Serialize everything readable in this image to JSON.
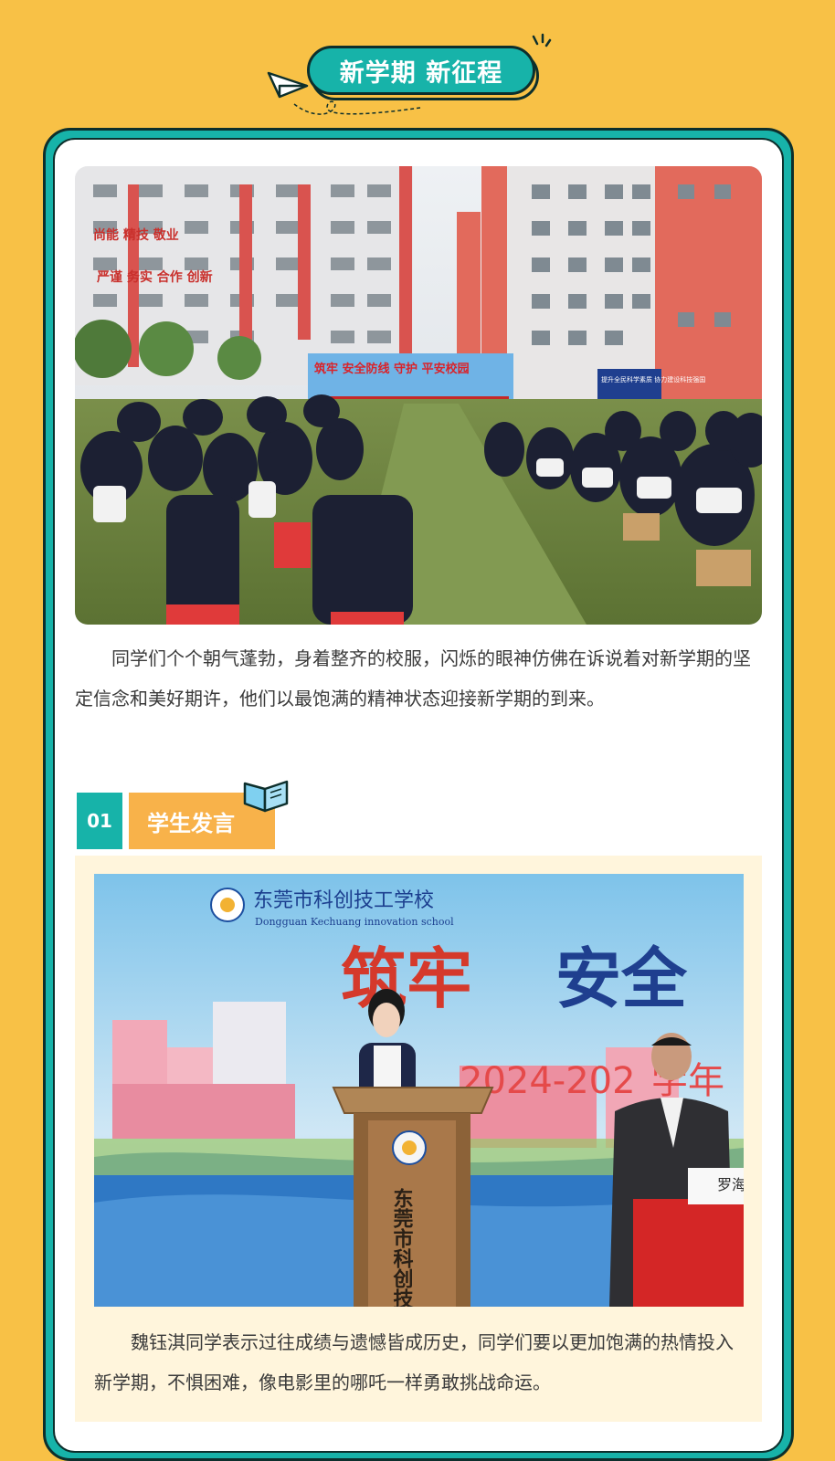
{
  "header": {
    "title": "新学期 新征程"
  },
  "photo1": {
    "banner_text": "筑牢 安全防线 守护 平安校园",
    "side_board": "提升全民科学素质 协力建设科技强国",
    "slogan_left": "尚能 精技 敬业",
    "slogan_left2": "严谨 务实 合作 创新"
  },
  "paragraph1": "同学们个个朝气蓬勃，身着整齐的校服，闪烁的眼神仿佛在诉说着对新学期的坚定信念和美好期许，他们以最饱满的精神状态迎接新学期的到来。",
  "section1": {
    "number": "01",
    "title": "学生发言"
  },
  "photo2": {
    "school_cn": "东莞市科创技工学校",
    "school_en": "Dongguan Kechuang innovation school",
    "slogan_red": "筑牢",
    "slogan_blue": "安全",
    "year": "2024-202",
    "year_suffix": "学年",
    "podium_text": "东莞市科创技工",
    "nameplate": "罗海"
  },
  "paragraph2": "魏钰淇同学表示过往成绩与遗憾皆成历史，同学们要以更加饱满的热情投入新学期，不惧困难，像电影里的哪吒一样勇敢挑战命运。",
  "colors": {
    "background": "#f8c146",
    "teal": "#17b3a9",
    "orange": "#f8b24a",
    "dark": "#0d2f2c"
  }
}
